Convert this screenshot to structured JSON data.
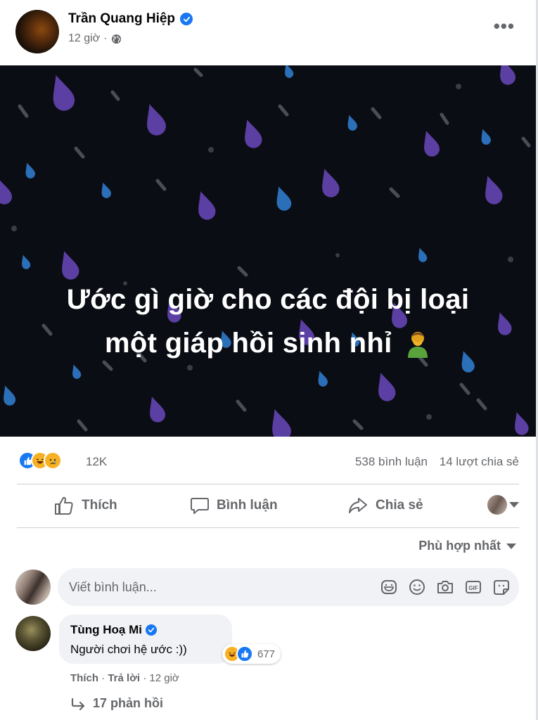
{
  "post": {
    "author": "Trần Quang Hiệp",
    "time": "12 giờ",
    "separator": "·",
    "more": "•••",
    "text_line1": "Ước gì giờ cho các đội bị loại",
    "text_line2": "một giáp hồi sinh nhỉ",
    "colors": {
      "image_bg": "#0b0d14",
      "drop_purple": "#5b3fa3",
      "drop_blue": "#2a6fb8",
      "accent": "#1877f2"
    }
  },
  "stats": {
    "reaction_icons": [
      "like-icon",
      "haha-icon",
      "sad-icon"
    ],
    "reaction_count": "12K",
    "comments": "538 bình luận",
    "shares": "14 lượt chia sẻ"
  },
  "actions": {
    "like": "Thích",
    "comment": "Bình luận",
    "share": "Chia sẻ"
  },
  "sort": {
    "label": "Phù hợp nhất"
  },
  "composer": {
    "placeholder": "Viết bình luận...",
    "icons": [
      "sticker-icon",
      "emoji-icon",
      "camera-icon",
      "gif-icon",
      "avatar-sticker-icon"
    ]
  },
  "comments": [
    {
      "name": "Tùng Hoạ Mi",
      "text": "Người chơi hệ ước :))",
      "reaction_count": "677",
      "like": "Thích",
      "reply": "Trả lời",
      "time": "12 giờ",
      "replies": "17 phản hồi"
    }
  ]
}
